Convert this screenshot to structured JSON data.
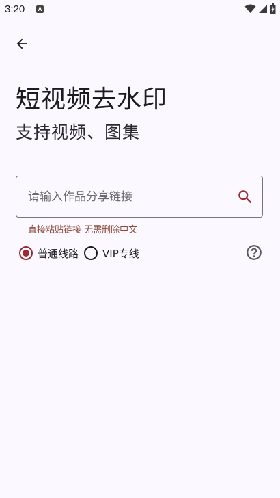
{
  "status_bar": {
    "time": "3:20",
    "app_badge": "A"
  },
  "header": {
    "back_icon": "arrow-back-icon"
  },
  "main": {
    "title": "短视频去水印",
    "subtitle": "支持视频、图集",
    "search": {
      "placeholder": "请输入作品分享链接",
      "value": ""
    },
    "hint": "直接粘贴链接 无需删除中文",
    "routes": [
      {
        "label": "普通线路",
        "selected": true
      },
      {
        "label": "VIP专线",
        "selected": false
      }
    ],
    "help_icon": "help-circle-icon"
  },
  "colors": {
    "accent": "#9b2b30",
    "background": "#fcf8ff",
    "hint": "#8a4a3a"
  }
}
